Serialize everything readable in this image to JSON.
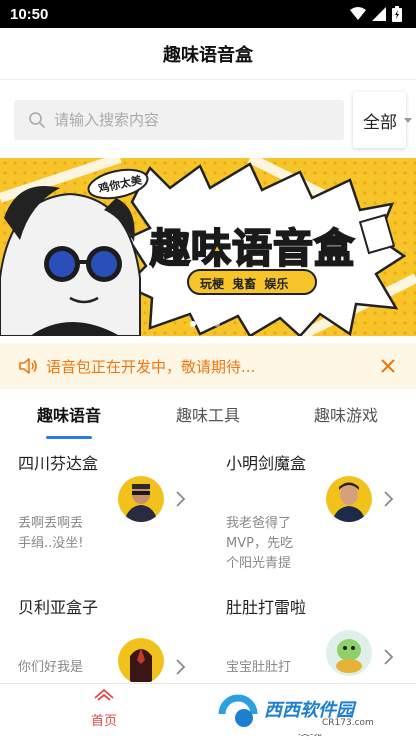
{
  "status_bar": {
    "time": "10:50"
  },
  "header": {
    "title": "趣味语音盒"
  },
  "search": {
    "placeholder": "请输入搜索内容",
    "value": "",
    "filter_label": "全部"
  },
  "banner": {
    "badge_text": "鸡你太美",
    "headline": "趣味语音盒",
    "tags": "玩梗 鬼畜 娱乐",
    "slide_count": 3,
    "active_slide": 1
  },
  "notice": {
    "text": "语音包正在开发中，敬请期待...",
    "accent": "#f0770f"
  },
  "tabs": [
    {
      "label": "趣味语音",
      "active": true
    },
    {
      "label": "趣味工具",
      "active": false
    },
    {
      "label": "趣味游戏",
      "active": false
    }
  ],
  "cards": [
    {
      "name": "四川芬达盒",
      "desc": "丢啊丢啊丢手绢..没坐!",
      "avatar_icon": "man-sunglasses-avatar"
    },
    {
      "name": "小明剑魔盒",
      "desc": "我老爸得了MVP，先吃个阳光青提",
      "avatar_icon": "man-portrait-avatar"
    },
    {
      "name": "贝利亚盒子",
      "desc": "你们好我是",
      "avatar_icon": "belial-avatar"
    },
    {
      "name": "肚肚打雷啦",
      "desc": "宝宝肚肚打",
      "avatar_icon": "turtle-avatar"
    }
  ],
  "bottom_nav": {
    "home_label": "首页",
    "second_label": "发现"
  },
  "watermark": {
    "brand": "西西软件园",
    "url": "CR173.com"
  },
  "colors": {
    "accent_blue": "#2a7de1",
    "home_red": "#e04848",
    "banner_yellow": "#f7c52a"
  }
}
